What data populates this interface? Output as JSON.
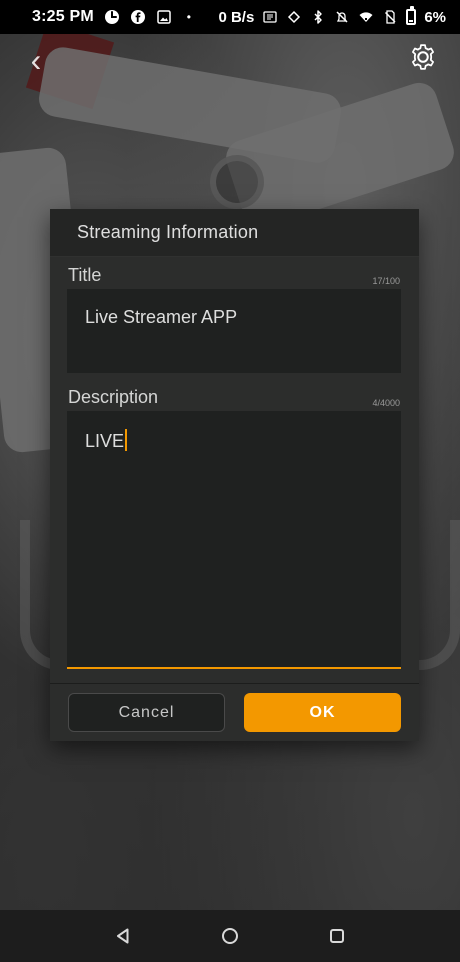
{
  "status_bar": {
    "time": "3:25 PM",
    "network_speed": "0 B/s",
    "battery_percent": "6%",
    "icons_left": [
      "data-saver-icon",
      "facebook-icon",
      "gallery-icon",
      "dot-icon"
    ],
    "icons_right": [
      "nfc-icon",
      "rotate-icon",
      "bluetooth-icon",
      "mute-icon",
      "wifi-icon",
      "no-sim-icon",
      "battery-icon"
    ]
  },
  "camera_overlay": {
    "back_icon": "chevron-left-icon",
    "settings_icon": "gear-icon"
  },
  "dialog": {
    "title": "Streaming Information",
    "fields": {
      "title": {
        "label": "Title",
        "count": "17/100",
        "value": "Live Streamer APP"
      },
      "description": {
        "label": "Description",
        "count": "4/4000",
        "value": "LIVE"
      }
    },
    "buttons": {
      "cancel": "Cancel",
      "ok": "OK"
    }
  },
  "colors": {
    "accent": "#f39800",
    "dialog_bg": "#2c2d2c",
    "field_bg": "#1f2120"
  }
}
